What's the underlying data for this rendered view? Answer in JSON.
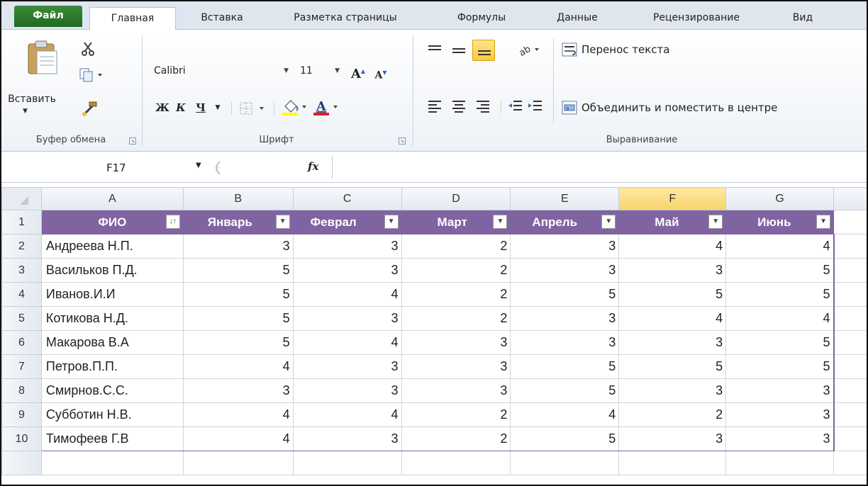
{
  "tabs": [
    "Файл",
    "Главная",
    "Вставка",
    "Разметка страницы",
    "Формулы",
    "Данные",
    "Рецензирование",
    "Вид"
  ],
  "ribbon": {
    "clipboard": {
      "paste_label": "Вставить",
      "group_label": "Буфер обмена"
    },
    "font": {
      "font_name": "Calibri",
      "font_size": "11",
      "group_label": "Шрифт",
      "bold": "Ж",
      "italic": "К",
      "underline": "Ч"
    },
    "alignment": {
      "wrap_text": "Перенос текста",
      "merge_center": "Объединить и поместить в центре",
      "group_label": "Выравнивание"
    }
  },
  "formula_bar": {
    "name_box": "F17",
    "fx_label": "fx",
    "formula": ""
  },
  "grid": {
    "columns": [
      "A",
      "B",
      "C",
      "D",
      "E",
      "F",
      "G"
    ],
    "selected_column": "F",
    "headers": [
      "ФИО",
      "Январь",
      "Феврал",
      "Март",
      "Апрель",
      "Май",
      "Июнь"
    ],
    "rows": [
      {
        "n": "2",
        "cells": [
          "Андреева Н.П.",
          "3",
          "3",
          "2",
          "3",
          "4",
          "4"
        ]
      },
      {
        "n": "3",
        "cells": [
          "Васильков П.Д.",
          "5",
          "3",
          "2",
          "3",
          "3",
          "5"
        ]
      },
      {
        "n": "4",
        "cells": [
          "Иванов.И.И",
          "5",
          "4",
          "2",
          "5",
          "5",
          "5"
        ]
      },
      {
        "n": "5",
        "cells": [
          "Котикова Н.Д.",
          "5",
          "3",
          "2",
          "3",
          "4",
          "4"
        ]
      },
      {
        "n": "6",
        "cells": [
          "Макарова В.А",
          "5",
          "4",
          "3",
          "3",
          "3",
          "5"
        ]
      },
      {
        "n": "7",
        "cells": [
          "Петров.П.П.",
          "4",
          "3",
          "3",
          "5",
          "5",
          "5"
        ]
      },
      {
        "n": "8",
        "cells": [
          "Смирнов.С.С.",
          "3",
          "3",
          "3",
          "5",
          "3",
          "3"
        ]
      },
      {
        "n": "9",
        "cells": [
          "Субботин Н.В.",
          "4",
          "4",
          "2",
          "4",
          "2",
          "3"
        ]
      },
      {
        "n": "10",
        "cells": [
          "Тимофеев Г.В",
          "4",
          "3",
          "2",
          "5",
          "3",
          "3"
        ]
      }
    ],
    "header_row_number": "1",
    "colors": {
      "table_header": "#8064a2",
      "selected_header": "#f7d36a",
      "file_tab": "#2e7d32"
    }
  }
}
